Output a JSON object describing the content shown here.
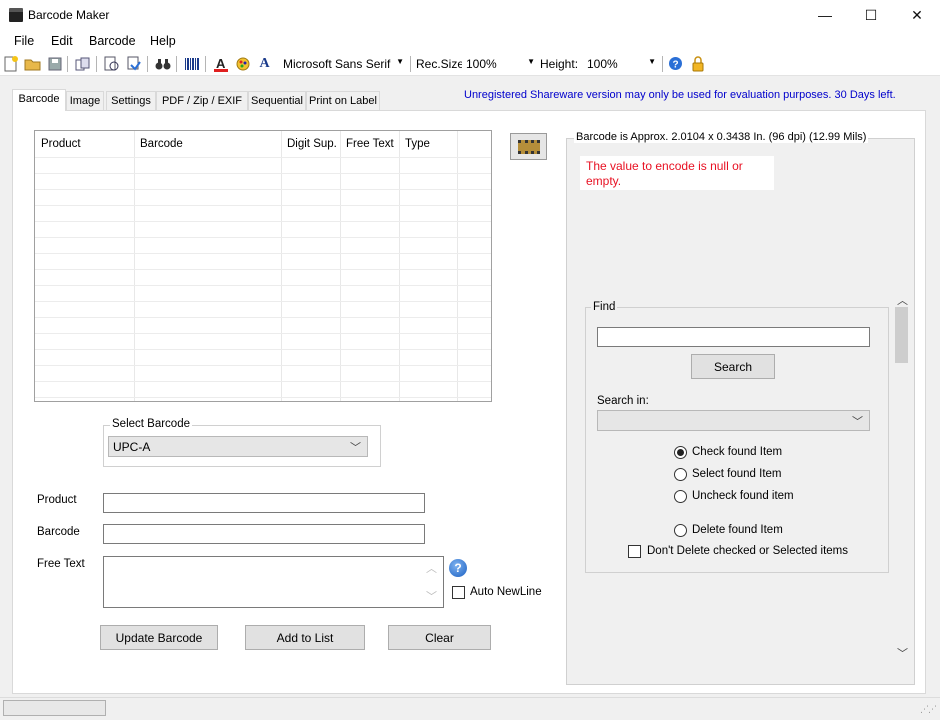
{
  "window": {
    "title": "Barcode Maker",
    "minimize": "—",
    "maximize": "☐",
    "close": "✕"
  },
  "menu": [
    "File",
    "Edit",
    "Barcode",
    "Help"
  ],
  "toolbar": {
    "font_value": "Microsoft Sans Serif",
    "rec_size_label": "Rec.Size",
    "rec_size_value": "100%",
    "height_label": "Height:",
    "height_value": "100%",
    "font_letter": "A"
  },
  "tabs": [
    {
      "label": "Barcode",
      "active": true
    },
    {
      "label": "Image"
    },
    {
      "label": "Settings"
    },
    {
      "label": "PDF / Zip / EXIF"
    },
    {
      "label": "Sequential"
    },
    {
      "label": "Print on Label"
    }
  ],
  "notice": "Unregistered Shareware version may only be used for evaluation purposes. 30 Days left.",
  "grid": {
    "columns": [
      "Product",
      "Barcode",
      "Digit Sup.",
      "Free Text",
      "Type"
    ]
  },
  "select_barcode": {
    "legend": "Select Barcode",
    "value": "UPC-A"
  },
  "form": {
    "product_label": "Product",
    "barcode_label": "Barcode",
    "free_text_label": "Free Text",
    "auto_newline_label": "Auto NewLine",
    "help_glyph": "?"
  },
  "buttons": {
    "update": "Update Barcode",
    "add": "Add to List",
    "clear": "Clear"
  },
  "preview": {
    "info": "Barcode is Approx. 2.0104 x 0.3438 In.  (96 dpi) (12.99 Mils)",
    "error": "The value to encode is null or empty.",
    "error_color": "#e81123"
  },
  "find": {
    "legend": "Find",
    "search_button": "Search",
    "search_in_label": "Search in:",
    "options": [
      {
        "label": "Check found Item",
        "selected": true
      },
      {
        "label": "Select found Item",
        "selected": false
      },
      {
        "label": "Uncheck found item",
        "selected": false
      },
      {
        "label": "Delete found Item",
        "selected": false
      }
    ],
    "dont_delete_label": "Don't Delete checked or Selected items"
  },
  "colors": {
    "notice": "#0000cc",
    "panel_bg": "#f0f0f0"
  }
}
